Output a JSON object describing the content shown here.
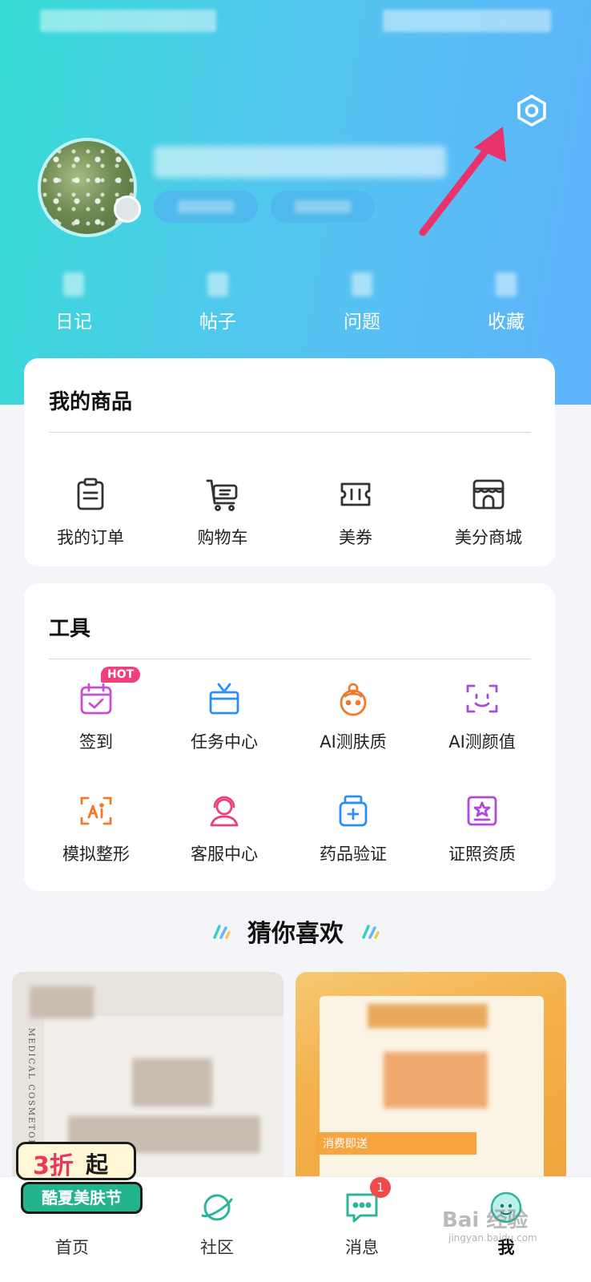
{
  "hero": {
    "stats": [
      {
        "label": "日记"
      },
      {
        "label": "帖子"
      },
      {
        "label": "问题"
      },
      {
        "label": "收藏"
      }
    ]
  },
  "goods": {
    "title": "我的商品",
    "items": [
      {
        "label": "我的订单",
        "icon": "order-list-icon"
      },
      {
        "label": "购物车",
        "icon": "shopping-cart-icon"
      },
      {
        "label": "美券",
        "icon": "coupon-icon"
      },
      {
        "label": "美分商城",
        "icon": "store-icon"
      }
    ]
  },
  "tools": {
    "title": "工具",
    "hot_badge": "HOT",
    "items": [
      {
        "label": "签到",
        "icon": "calendar-check-icon",
        "color": "#c94ed0"
      },
      {
        "label": "任务中心",
        "icon": "gift-box-icon",
        "color": "#2c8ff0"
      },
      {
        "label": "AI测肤质",
        "icon": "face-icon",
        "color": "#f07a2c"
      },
      {
        "label": "AI测颜值",
        "icon": "face-scan-icon",
        "color": "#a44cd8"
      },
      {
        "label": "模拟整形",
        "icon": "ai-frame-icon",
        "color": "#f07a2c"
      },
      {
        "label": "客服中心",
        "icon": "headset-agent-icon",
        "color": "#ec3f7a"
      },
      {
        "label": "药品验证",
        "icon": "medicine-bottle-icon",
        "color": "#2c8ff0"
      },
      {
        "label": "证照资质",
        "icon": "certificate-icon",
        "color": "#b14ad8"
      }
    ]
  },
  "recommend": {
    "title": "猜你喜欢",
    "left_product_text": "MEDICAL COSMETOLOG",
    "right_product_text": "消费即送"
  },
  "promo": {
    "big": "3折",
    "suffix": "起",
    "label": "酷夏美肤节"
  },
  "tabbar": {
    "items": [
      {
        "label": "首页"
      },
      {
        "label": "社区"
      },
      {
        "label": "消息",
        "badge": "1"
      },
      {
        "label": "我"
      }
    ]
  },
  "watermark": {
    "main": "Bai 经验",
    "sub": "jingyan.baidu.com"
  },
  "colors": {
    "hero_start": "#34dcd4",
    "hero_end": "#5fb3fb",
    "arrow": "#e8336c",
    "badge": "#f04a4a"
  }
}
